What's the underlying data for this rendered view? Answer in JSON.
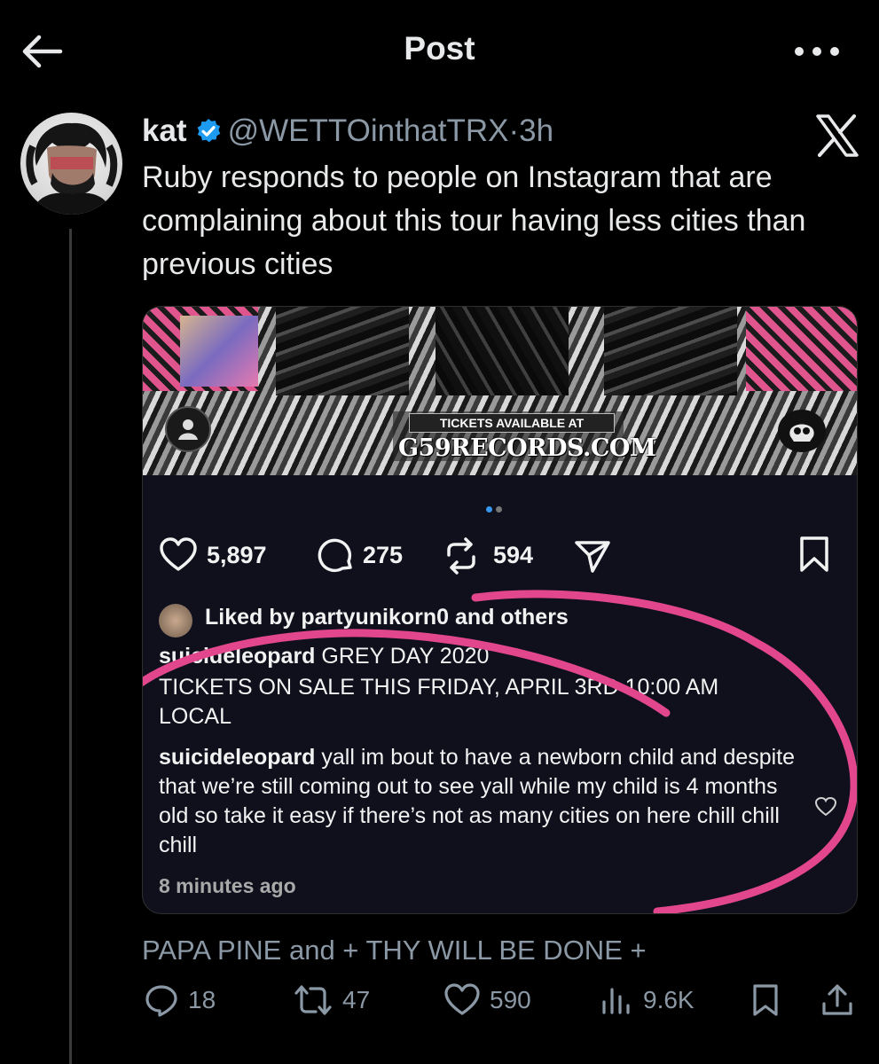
{
  "header": {
    "title": "Post",
    "back_icon": "arrow-left-icon",
    "more_icon": "more-horizontal-icon"
  },
  "tweet": {
    "author_name": "kat",
    "handle": "@WETTOinthatTRX",
    "separator": "·",
    "time": "3h",
    "text": "Ruby responds to people on Instagram that are complaining about this tour having less cities than previous cities",
    "verified_color": "#1d9bf0",
    "reply_context": "PAPA PINE and + THY WILL BE DONE +",
    "actions": {
      "replies": "18",
      "retweets": "47",
      "likes": "590",
      "views": "9.6K"
    }
  },
  "media": {
    "tickets_label": "TICKETS AVAILABLE AT",
    "site": "G59RECORDS.COM",
    "carousel_dot_active_color": "#3797f0",
    "likes": "5,897",
    "comments": "275",
    "reposts": "594",
    "liked_by": "Liked by",
    "liked_user": "partyunikorn0",
    "liked_and_others": "and others",
    "caption_user": "suicideleopard",
    "caption_text": "GREY DAY 2020",
    "caption_line2": "TICKETS ON SALE THIS FRIDAY, APRIL 3RD 10:00 AM",
    "caption_line3": "LOCAL",
    "comment_user": "suicideleopard",
    "comment_text": "yall im bout to have a newborn child and despite that we’re still coming out to see yall while my child is 4 months old so take it easy if there’s not as many cities on here chill chill chill",
    "time_ago": "8 minutes ago",
    "annotation_color": "#e2478d"
  }
}
